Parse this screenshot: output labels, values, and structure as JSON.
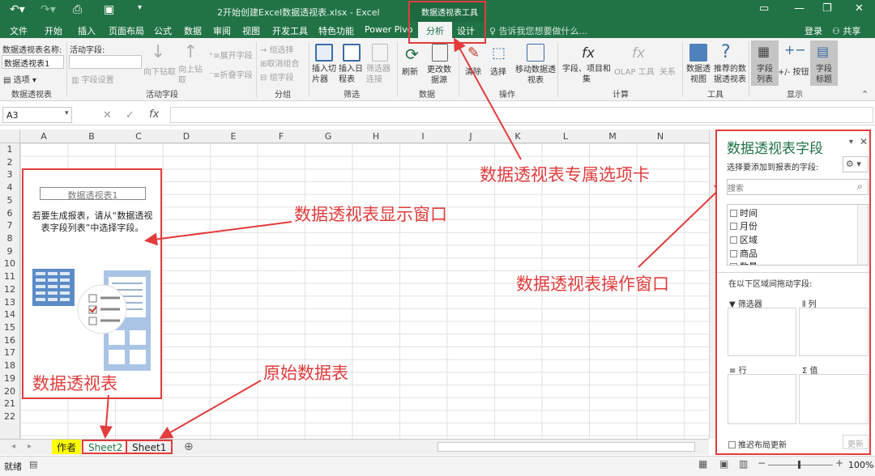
{
  "window": {
    "title": "2开始创建Excel数据透视表.xlsx - Excel",
    "context_tools": "数据透视表工具",
    "login": "登录",
    "share": "共享"
  },
  "tabs": [
    "文件",
    "开始",
    "插入",
    "页面布局",
    "公式",
    "数据",
    "审阅",
    "视图",
    "开发工具",
    "特色功能",
    "Power Pivo",
    "分析",
    "设计"
  ],
  "tell_me": "告诉我您想要做什么...",
  "ribbon": {
    "pivot_name_label": "数据透视表名称:",
    "pivot_name_value": "数据透视表1",
    "options": "选项",
    "active_field_label": "活动字段:",
    "field_settings": "字段设置",
    "drill_down": "向下钻取",
    "drill_up": "向上钻取",
    "expand_field": "展开字段",
    "collapse_field": "折叠字段",
    "group_selection": "组选择",
    "ungroup": "取消组合",
    "group_field": "组字段",
    "insert_slicer": "插入切片器",
    "insert_timeline": "插入日程表",
    "filter_connections": "筛选器连接",
    "refresh": "刷新",
    "change_source": "更改数据源",
    "clear": "清除",
    "select": "选择",
    "move_pivot": "移动数据透视表",
    "fields_items_sets": "字段、项目和集",
    "olap_tools": "OLAP 工具",
    "relationships": "关系",
    "pivot_chart": "数据透视图",
    "recommended_pivot": "推荐的数据透视表",
    "field_list": "字段列表",
    "plus_minus_buttons": "+/- 按钮",
    "field_headers": "字段标题",
    "groups": {
      "pivot": "数据透视表",
      "active_field": "活动字段",
      "group": "分组",
      "filter": "筛选",
      "data": "数据",
      "actions": "操作",
      "calculations": "计算",
      "tools": "工具",
      "show": "显示"
    }
  },
  "formula_bar": {
    "name_box": "A3",
    "fx": "fx"
  },
  "columns": [
    "A",
    "B",
    "C",
    "D",
    "E",
    "F",
    "G",
    "H",
    "I",
    "J",
    "K",
    "L",
    "M",
    "N"
  ],
  "rows": [
    "1",
    "2",
    "3",
    "4",
    "5",
    "6",
    "7",
    "8",
    "9",
    "10",
    "11",
    "12",
    "13",
    "14",
    "15",
    "16",
    "17",
    "18",
    "19",
    "20",
    "21",
    "22"
  ],
  "pivot_placeholder": {
    "name": "数据透视表1",
    "instruction_line1": "若要生成报表，请从“数据透视",
    "instruction_line2": "表字段列表”中选择字段。"
  },
  "annotations": {
    "exclusive_tab": "数据透视表专属选项卡",
    "display_window": "数据透视表显示窗口",
    "operation_window": "数据透视表操作窗口",
    "pivot_table": "数据透视表",
    "source_data": "原始数据表"
  },
  "sheets": [
    "作者",
    "Sheet2",
    "Sheet1"
  ],
  "status": {
    "ready": "就绪",
    "zoom": "100%"
  },
  "field_pane": {
    "title": "数据透视表字段",
    "choose_fields": "选择要添加到报表的字段:",
    "search_placeholder": "搜索",
    "fields": [
      "时间",
      "月份",
      "区域",
      "商品",
      "数量"
    ],
    "drag_label": "在以下区域间拖动字段:",
    "areas": {
      "filters": "筛选器",
      "columns": "列",
      "rows": "行",
      "values": "值"
    },
    "defer_update": "推迟布局更新",
    "update": "更新"
  },
  "colors": {
    "excel_green": "#217346",
    "annotation_red": "#e23c3c",
    "sheet_tab_yellow": "#ffff00"
  }
}
